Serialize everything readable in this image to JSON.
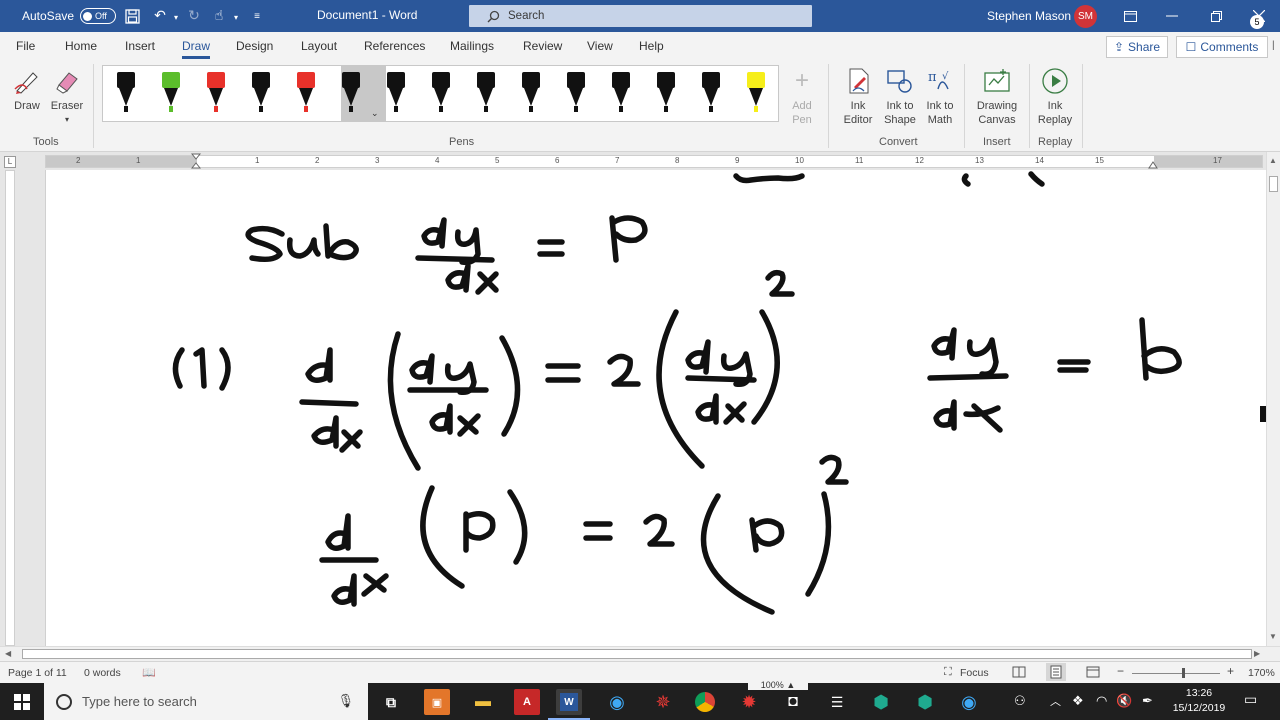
{
  "titlebar": {
    "autosave_label": "AutoSave",
    "autosave_state": "Off",
    "document_title": "Document1 - Word",
    "search_placeholder": "Search",
    "user_name": "Stephen Mason",
    "user_initials": "SM"
  },
  "tabs": [
    "File",
    "Home",
    "Insert",
    "Draw",
    "Design",
    "Layout",
    "References",
    "Mailings",
    "Review",
    "View",
    "Help"
  ],
  "active_tab": "Draw",
  "share_label": "Share",
  "comments_label": "Comments",
  "ribbon": {
    "draw_label": "Draw",
    "eraser_label": "Eraser",
    "tools_group": "Tools",
    "pens_group": "Pens",
    "add_pen_label": "Add\nPen",
    "ink_editor_label": "Ink\nEditor",
    "ink_to_shape_label": "Ink to\nShape",
    "ink_to_math_label": "Ink to\nMath",
    "convert_group": "Convert",
    "drawing_canvas_label": "Drawing\nCanvas",
    "insert_group": "Insert",
    "ink_replay_label": "Ink\nReplay",
    "replay_group": "Replay",
    "pens": [
      {
        "color": "#111111",
        "tip": "#111111"
      },
      {
        "color": "#5bbd2b",
        "tip": "#5bbd2b"
      },
      {
        "color": "#e8312a",
        "tip": "#e8312a"
      },
      {
        "color": "#111111",
        "tip": "#111111"
      },
      {
        "color": "#e8312a",
        "tip": "#e8312a"
      },
      {
        "color": "#111111",
        "tip": "#111111"
      },
      {
        "color": "#111111",
        "tip": "#111111"
      },
      {
        "color": "#111111",
        "tip": "#111111"
      },
      {
        "color": "#111111",
        "tip": "#111111"
      },
      {
        "color": "#111111",
        "tip": "#111111"
      },
      {
        "color": "#111111",
        "tip": "#111111"
      },
      {
        "color": "#111111",
        "tip": "#111111"
      },
      {
        "color": "#111111",
        "tip": "#111111"
      },
      {
        "color": "#111111",
        "tip": "#111111"
      },
      {
        "color": "#f6ee1a",
        "tip": "#f6ee1a"
      }
    ]
  },
  "ruler_numbers": [
    "2",
    "1",
    "1",
    "2",
    "3",
    "4",
    "5",
    "6",
    "7",
    "8",
    "9",
    "10",
    "11",
    "12",
    "13",
    "14",
    "15",
    "17"
  ],
  "status": {
    "page_info": "Page 1 of 11",
    "word_count": "0 words",
    "focus_label": "Focus",
    "zoom_level": "170%",
    "zoom_popup": "100%"
  },
  "taskbar": {
    "search_placeholder": "Type here to search",
    "time": "13:26",
    "date": "15/12/2019",
    "notification_count": "5"
  },
  "colors": {
    "accent": "#2b579a",
    "avatar": "#d13438"
  }
}
